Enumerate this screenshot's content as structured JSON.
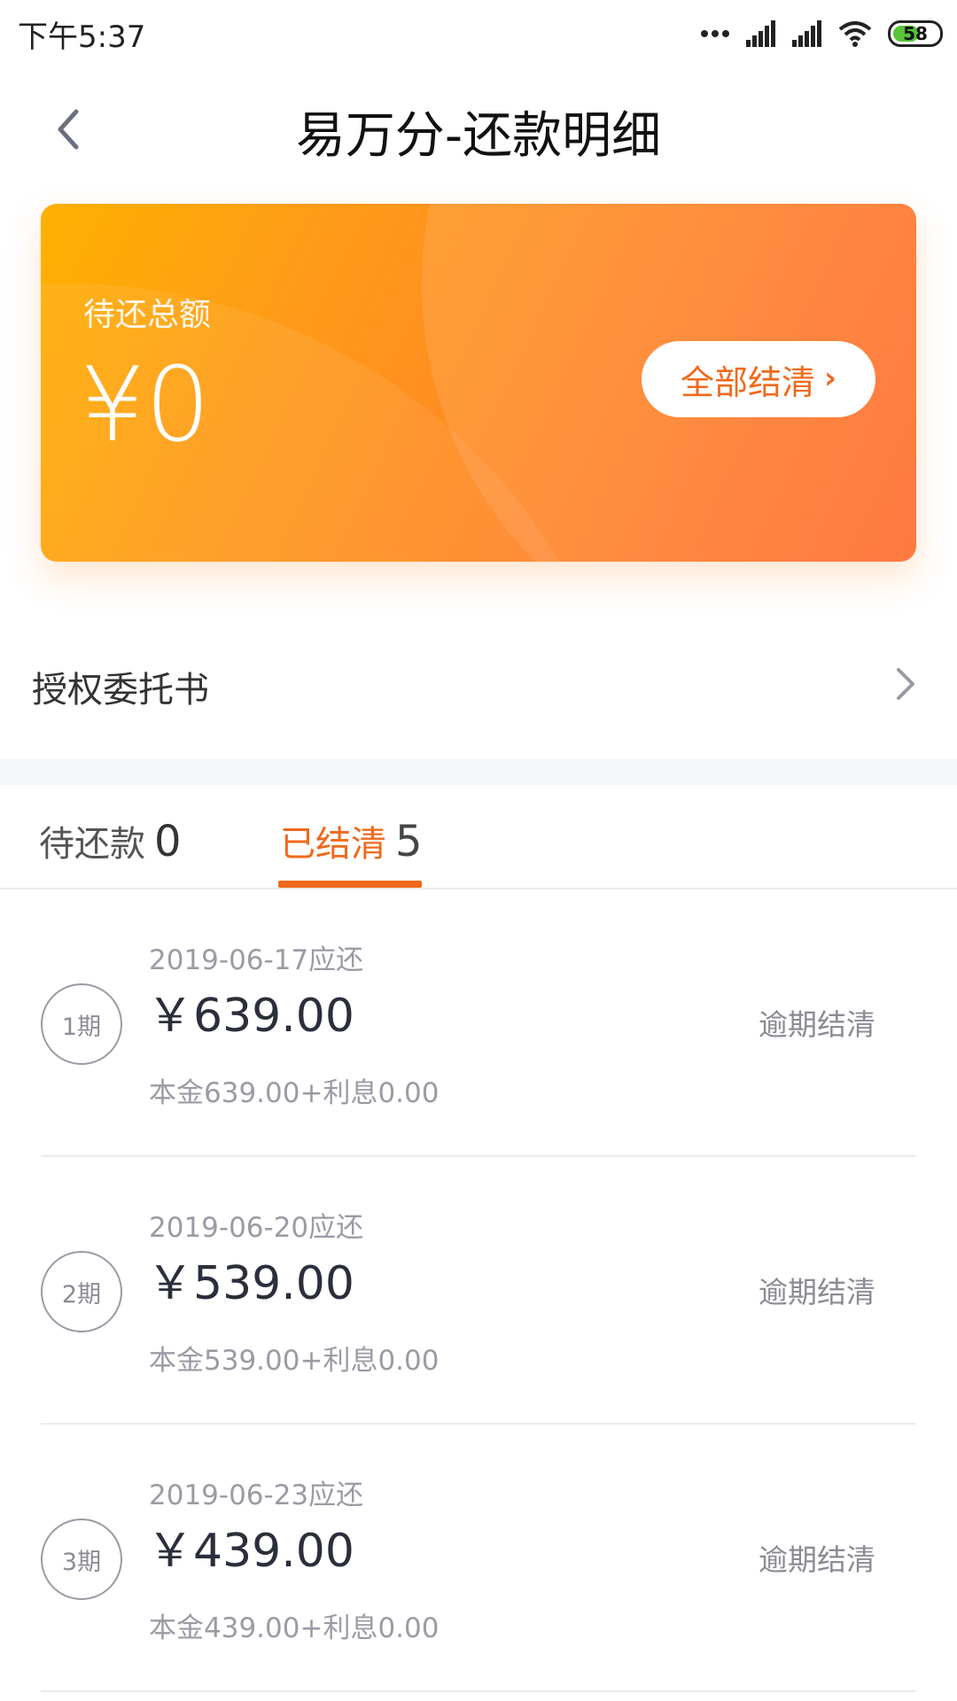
{
  "status_bar": {
    "time": "下午5:37",
    "battery_level": "58",
    "battery_fraction": 0.58,
    "accent_battery": "#57c43a",
    "icons": [
      "more-dots-icon",
      "signal-icon",
      "signal-icon",
      "wifi-icon",
      "battery-icon"
    ]
  },
  "header": {
    "title": "易万分-还款明细",
    "back_icon": "chevron-left-icon"
  },
  "summary": {
    "label": "待还总额",
    "amount": "¥0",
    "settle_all_label": "全部结清",
    "settle_chevron": "›",
    "gradient_colors": [
      "#ffb000",
      "#ff6a2c"
    ]
  },
  "authorization": {
    "label": "授权委托书",
    "chevron_icon": "chevron-right-icon"
  },
  "tabs": [
    {
      "label": "待还款",
      "count": "0",
      "active": false
    },
    {
      "label": "已结清",
      "count": "5",
      "active": true
    }
  ],
  "accent_color": "#f06a1c",
  "items": [
    {
      "period": "1期",
      "due_date": "2019-06-17应还",
      "amount": "￥639.00",
      "breakdown": "本金639.00+利息0.00",
      "status": "逾期结清"
    },
    {
      "period": "2期",
      "due_date": "2019-06-20应还",
      "amount": "￥539.00",
      "breakdown": "本金539.00+利息0.00",
      "status": "逾期结清"
    },
    {
      "period": "3期",
      "due_date": "2019-06-23应还",
      "amount": "￥439.00",
      "breakdown": "本金439.00+利息0.00",
      "status": "逾期结清"
    }
  ]
}
